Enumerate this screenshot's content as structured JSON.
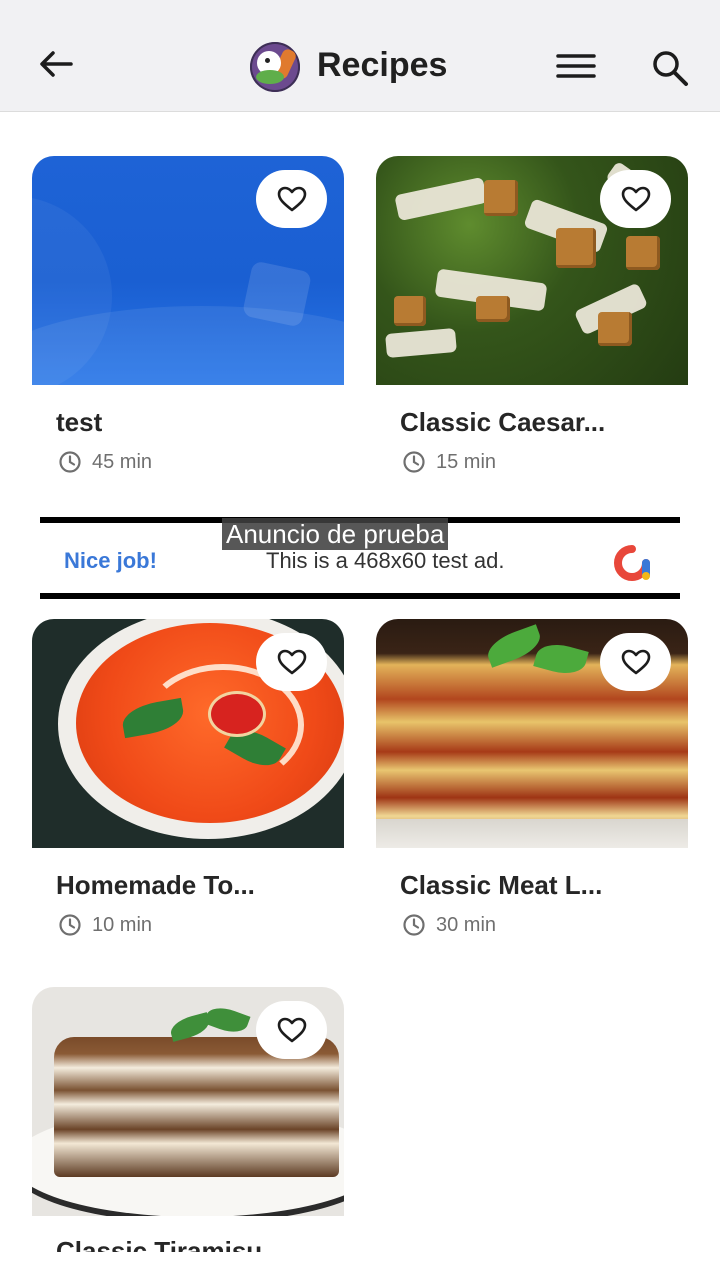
{
  "app_bar": {
    "title": "Recipes",
    "icons": {
      "back": "arrow-left-icon",
      "logo": "app-logo",
      "menu": "hamburger-menu-icon",
      "search": "search-icon"
    }
  },
  "recipes": [
    {
      "title": "test",
      "time": "45 min",
      "image": "blue-placeholder"
    },
    {
      "title": "Classic Caesar...",
      "time": "15 min",
      "image": "caesar-salad"
    },
    {
      "title": "Homemade To...",
      "time": "10 min",
      "image": "tomato-soup"
    },
    {
      "title": "Classic Meat L...",
      "time": "30 min",
      "image": "meat-lasagna"
    },
    {
      "title": "Classic Tiramisu",
      "time": "",
      "image": "tiramisu"
    }
  ],
  "ad": {
    "label": "Anuncio de prueba",
    "headline": "Nice job!",
    "body": "This is a 468x60 test ad.",
    "icon": "ads-logo-icon"
  },
  "colors": {
    "app_bar_bg": "#f1f1f3",
    "ad_headline": "#3a78d8",
    "text": "#262626",
    "meta": "#6f6f6f"
  }
}
